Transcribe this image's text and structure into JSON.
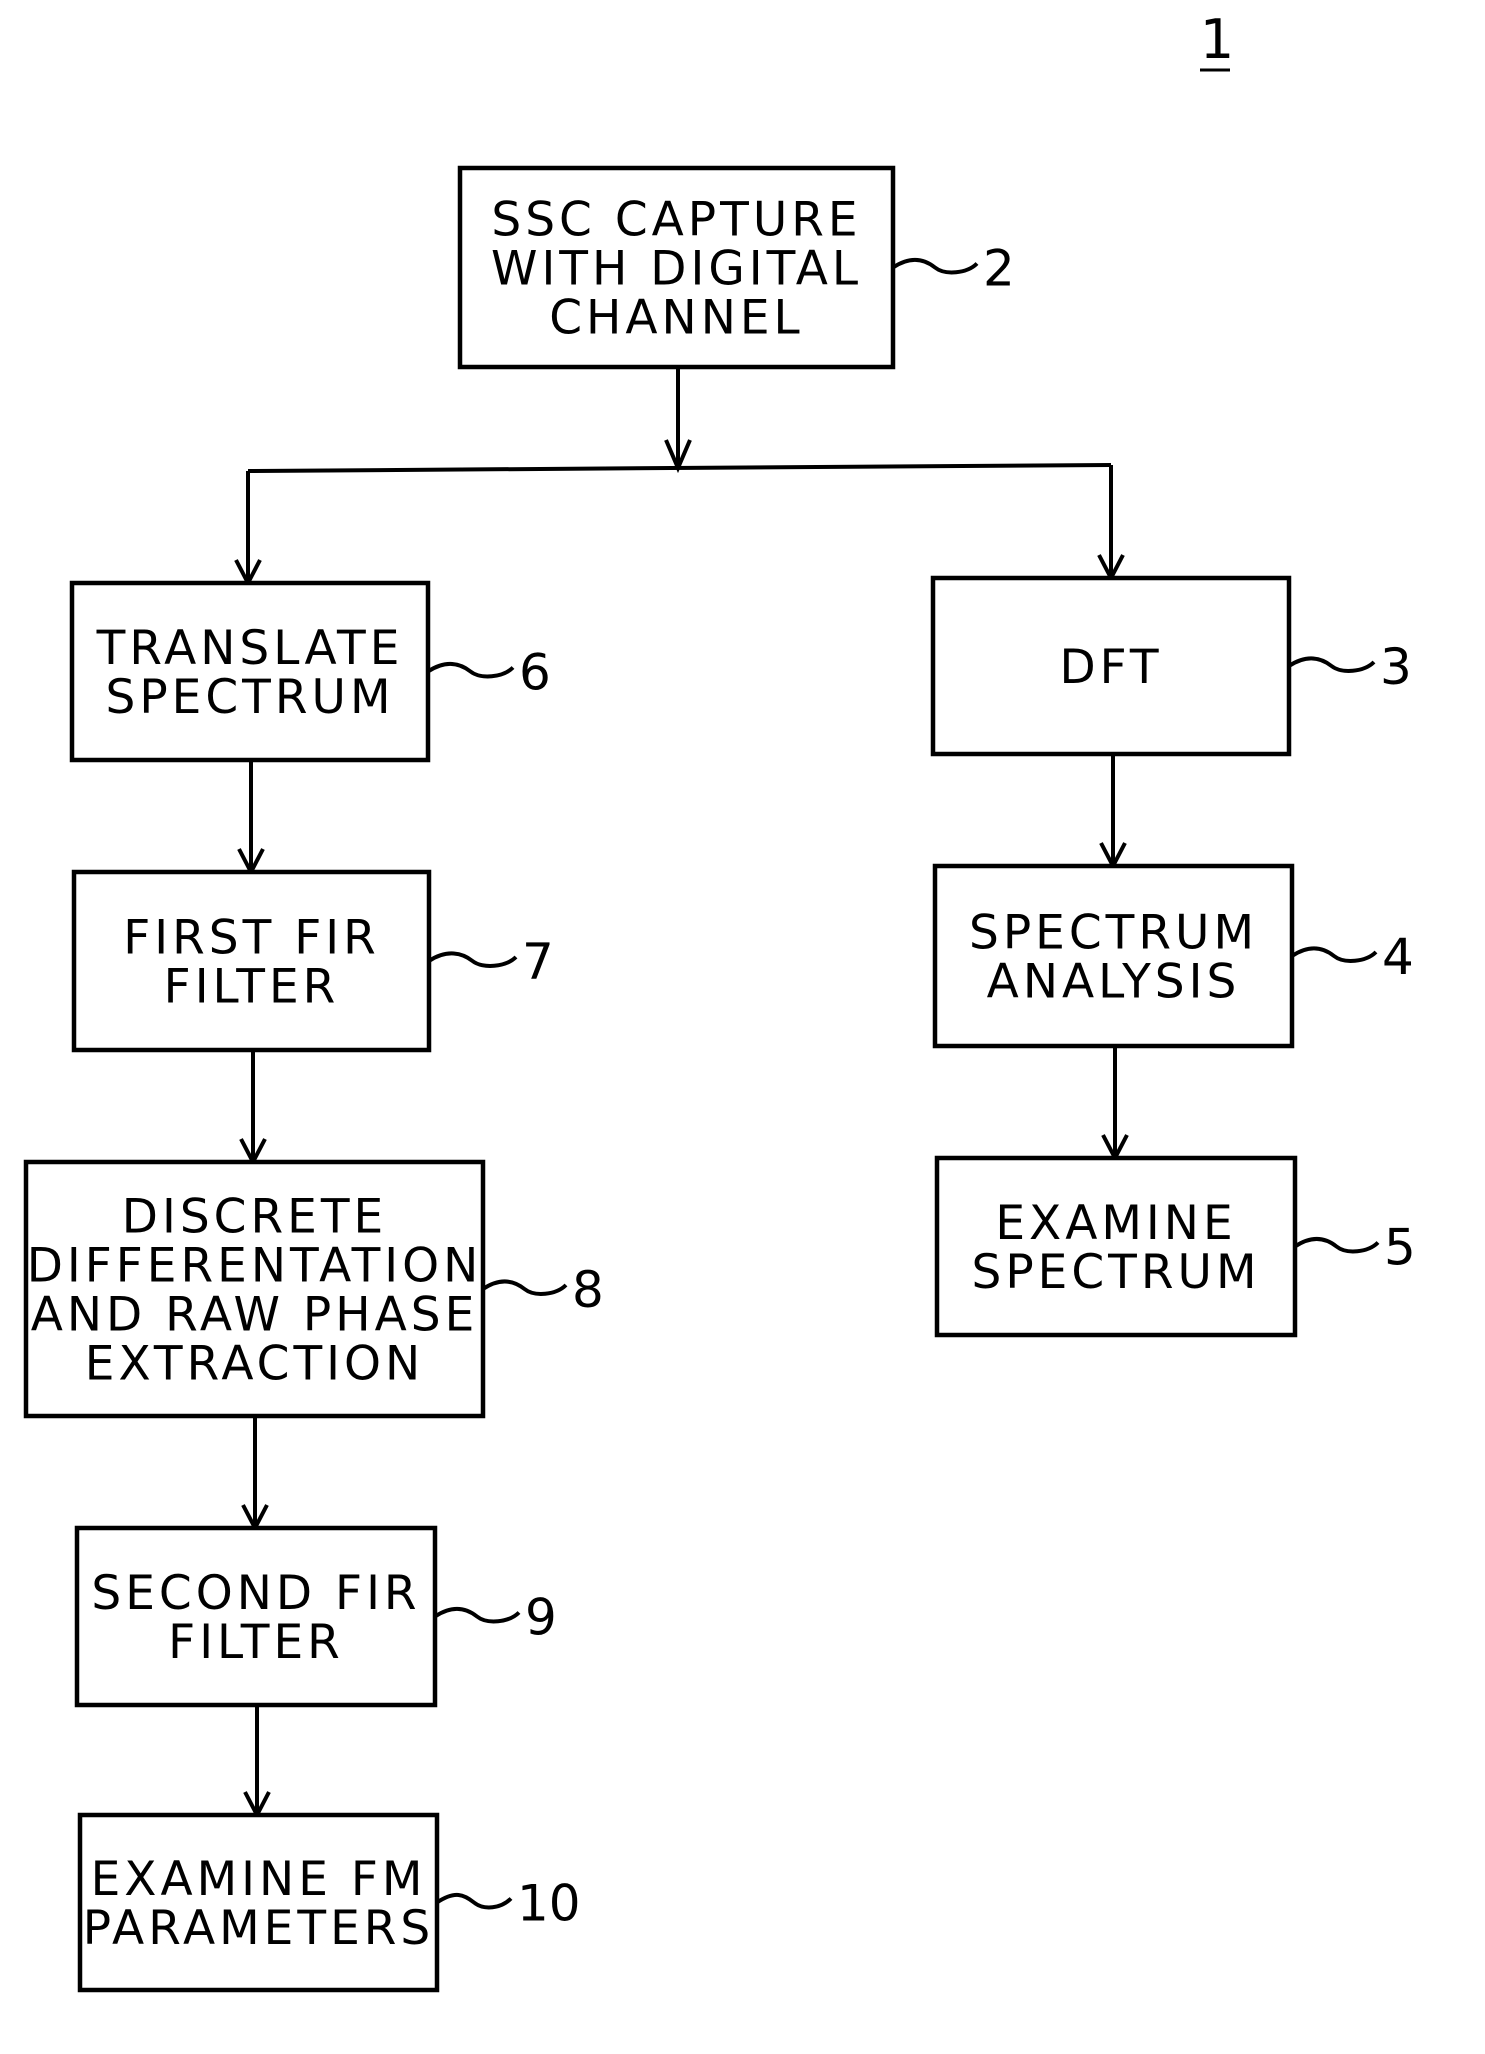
{
  "figure": {
    "number": "1",
    "colors": {
      "ink": "#000000",
      "background": "#ffffff"
    }
  },
  "blocks": [
    {
      "id": "b2",
      "ref": "2",
      "lines": [
        "SSC CAPTURE",
        "WITH DIGITAL",
        "CHANNEL"
      ]
    },
    {
      "id": "b3",
      "ref": "3",
      "lines": [
        "DFT"
      ]
    },
    {
      "id": "b4",
      "ref": "4",
      "lines": [
        "SPECTRUM",
        "ANALYSIS"
      ]
    },
    {
      "id": "b5",
      "ref": "5",
      "lines": [
        "EXAMINE",
        "SPECTRUM"
      ]
    },
    {
      "id": "b6",
      "ref": "6",
      "lines": [
        "TRANSLATE",
        "SPECTRUM"
      ]
    },
    {
      "id": "b7",
      "ref": "7",
      "lines": [
        "FIRST FIR",
        "FILTER"
      ]
    },
    {
      "id": "b8",
      "ref": "8",
      "lines": [
        "DISCRETE",
        "DIFFERENTATION",
        "AND RAW PHASE",
        "EXTRACTION"
      ]
    },
    {
      "id": "b9",
      "ref": "9",
      "lines": [
        "SECOND FIR",
        "FILTER"
      ]
    },
    {
      "id": "b10",
      "ref": "10",
      "lines": [
        "EXAMINE FM",
        "PARAMETERS"
      ]
    }
  ],
  "connections": [
    {
      "from": "b2",
      "to": "b6"
    },
    {
      "from": "b2",
      "to": "b3"
    },
    {
      "from": "b3",
      "to": "b4"
    },
    {
      "from": "b4",
      "to": "b5"
    },
    {
      "from": "b6",
      "to": "b7"
    },
    {
      "from": "b7",
      "to": "b8"
    },
    {
      "from": "b8",
      "to": "b9"
    },
    {
      "from": "b9",
      "to": "b10"
    }
  ]
}
